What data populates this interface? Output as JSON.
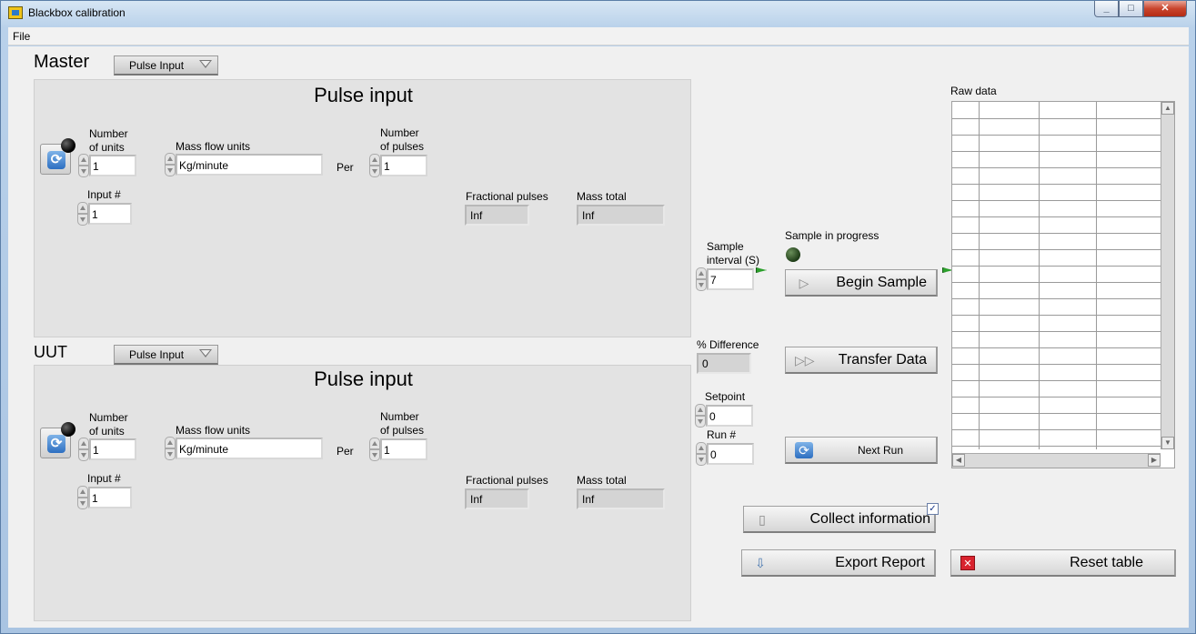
{
  "window": {
    "title": "Blackbox calibration"
  },
  "menu": {
    "file": "File"
  },
  "master": {
    "section_label": "Master",
    "mode_select": "Pulse Input",
    "panel_title": "Pulse input",
    "number_of_units_label": "Number\nof units",
    "number_of_units": "1",
    "mass_flow_units_label": "Mass flow units",
    "mass_flow_units": "Kg/minute",
    "per_label": "Per",
    "number_of_pulses_label": "Number\nof pulses",
    "number_of_pulses": "1",
    "input_label": "Input #",
    "input_value": "1",
    "fractional_pulses_label": "Fractional pulses",
    "fractional_pulses": "Inf",
    "mass_total_label": "Mass total",
    "mass_total": "Inf"
  },
  "uut": {
    "section_label": "UUT",
    "mode_select": "Pulse Input",
    "panel_title": "Pulse input",
    "number_of_units_label": "Number\nof units",
    "number_of_units": "1",
    "mass_flow_units_label": "Mass flow units",
    "mass_flow_units": "Kg/minute",
    "per_label": "Per",
    "number_of_pulses_label": "Number\nof pulses",
    "number_of_pulses": "1",
    "input_label": "Input #",
    "input_value": "1",
    "fractional_pulses_label": "Fractional pulses",
    "fractional_pulses": "Inf",
    "mass_total_label": "Mass total",
    "mass_total": "Inf"
  },
  "controls": {
    "sample_interval_label": "Sample\ninterval (S)",
    "sample_interval": "7",
    "sample_in_progress_label": "Sample in progress",
    "begin_sample": "Begin Sample",
    "percent_difference_label": "% Difference",
    "percent_difference": "0",
    "transfer_data": "Transfer Data",
    "setpoint_label": "Setpoint",
    "setpoint": "0",
    "run_label": "Run #",
    "run": "0",
    "next_run": "Next Run",
    "collect_information": "Collect information",
    "collect_information_checked": true,
    "export_report": "Export Report",
    "reset_table": "Reset table"
  },
  "raw_data": {
    "label": "Raw data",
    "rows": 21,
    "columns": 4
  },
  "colors": {
    "panel": "#e3e3e3",
    "background": "#f0f0f0",
    "led_off": "#000000",
    "sample_led": "#1d3b16",
    "reset_icon": "#d9232e"
  }
}
